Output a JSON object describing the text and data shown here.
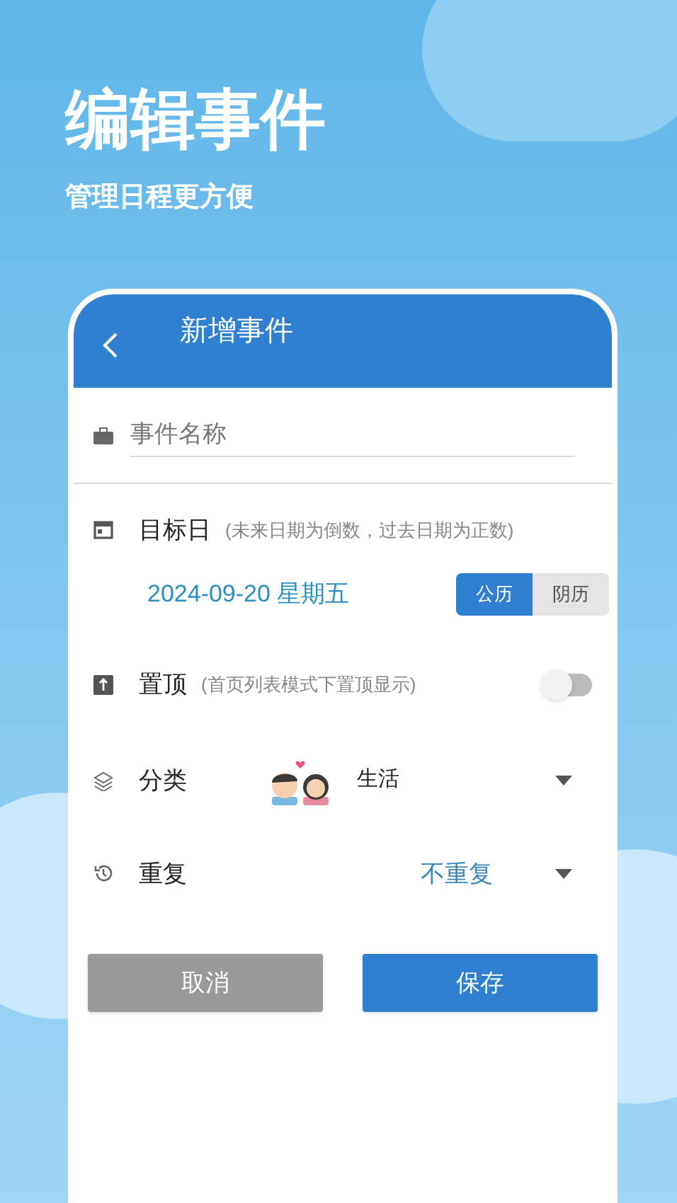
{
  "headline": "编辑事件",
  "subheadline": "管理日程更方便",
  "header": {
    "title": "新增事件"
  },
  "name_field": {
    "placeholder": "事件名称"
  },
  "target_day": {
    "label": "目标日",
    "hint": "(未来日期为倒数，过去日期为正数)",
    "date": "2024-09-20 星期五",
    "calendars": [
      {
        "label": "公历",
        "selected": true
      },
      {
        "label": "阴历",
        "selected": false
      }
    ]
  },
  "pin": {
    "label": "置顶",
    "hint": "(首页列表模式下置顶显示)",
    "on": false
  },
  "category": {
    "label": "分类",
    "value": "生活"
  },
  "repeat": {
    "label": "重复",
    "value": "不重复"
  },
  "buttons": [
    {
      "label": "取消",
      "kind": "secondary"
    },
    {
      "label": "保存",
      "kind": "primary"
    }
  ]
}
